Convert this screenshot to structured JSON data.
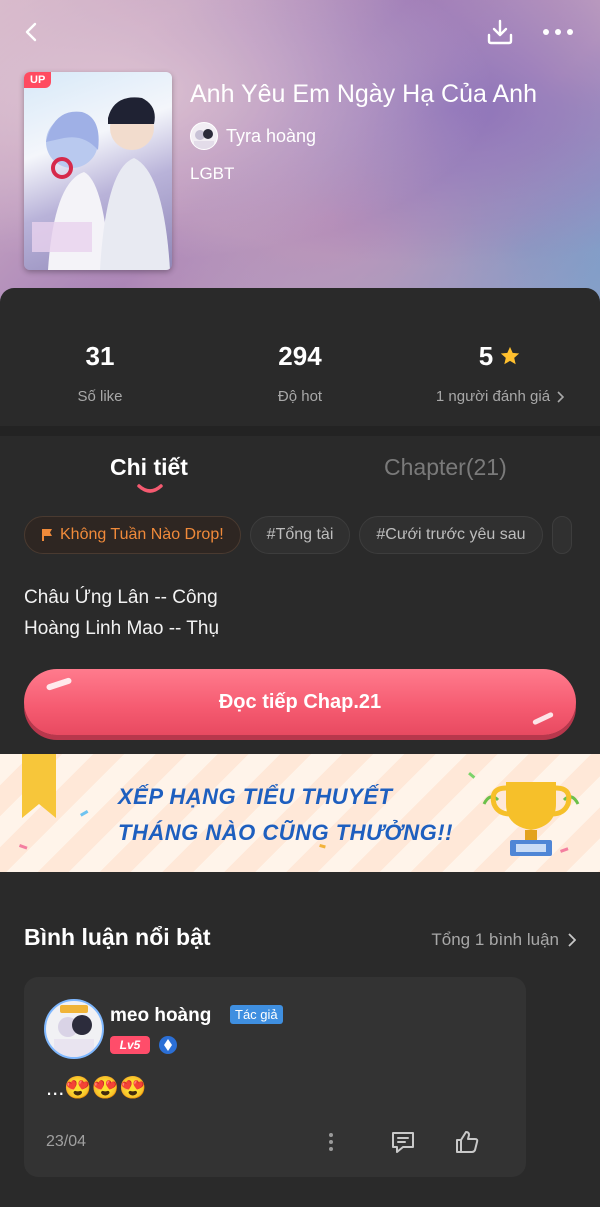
{
  "header": {
    "title": "Anh Yêu Em Ngày Hạ Của Anh",
    "author": "Tyra hoàng",
    "genre": "LGBT",
    "cover_badge": "UP"
  },
  "stats": [
    {
      "value": "31",
      "label": "Số like"
    },
    {
      "value": "294",
      "label": "Độ hot"
    },
    {
      "value": "5",
      "label": "1 người đánh giá"
    }
  ],
  "tabs": [
    {
      "label": "Chi tiết",
      "active": true
    },
    {
      "label": "Chapter(21)",
      "active": false
    }
  ],
  "tags": [
    "Không Tuần Nào Drop!",
    "#Tổng tài",
    "#Cưới trước yêu sau"
  ],
  "description": [
    "Châu Ứng Lân -- Công",
    "Hoàng Linh Mao -- Thụ"
  ],
  "cta": {
    "label": "Đọc tiếp Chap.21"
  },
  "banner": {
    "line1": "XẾP HẠNG TIỂU THUYẾT",
    "line2": "THÁNG NÀO CŨNG THƯỞNG!!"
  },
  "comments": {
    "title": "Bình luận nổi bật",
    "total": "Tổng 1 bình luận",
    "items": [
      {
        "name": "meo hoàng",
        "badge": "Tác giả",
        "level": "Lv5",
        "text": "...😍😍😍",
        "date": "23/04"
      }
    ]
  },
  "colors": {
    "accent": "#f55a70",
    "star": "#ffc02e",
    "tag_warn": "#f08a3a",
    "author_badge": "#3f8fe0",
    "background": "#2a2a2a"
  }
}
